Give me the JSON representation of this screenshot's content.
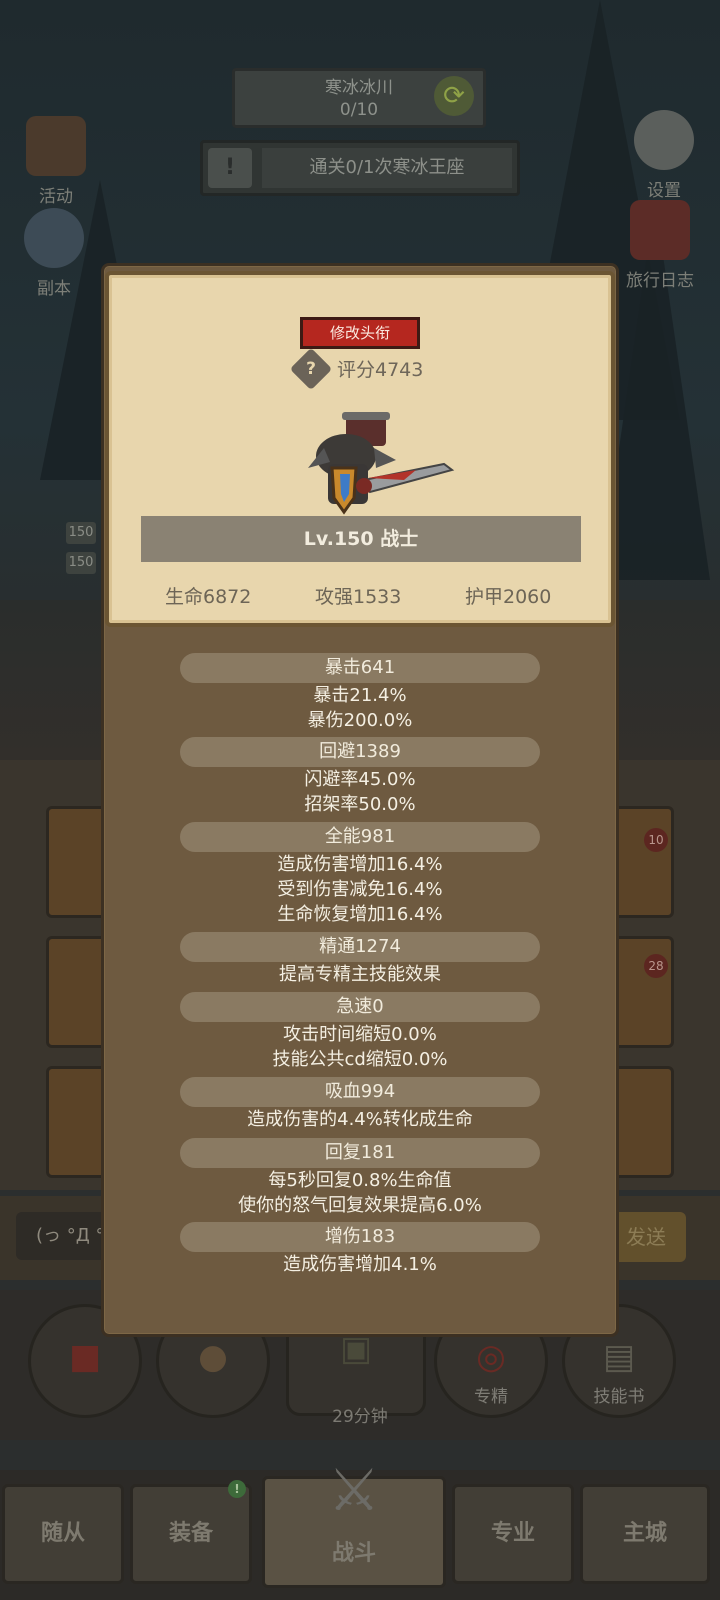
{
  "top": {
    "stage_name": "寒冰冰川",
    "stage_progress": "0/10",
    "quest_text": "通关0/1次寒冰王座",
    "left_menu": [
      "活动",
      "副本"
    ],
    "right_menu": [
      "设置",
      "旅行日志"
    ],
    "level_tags": [
      "150",
      "150"
    ]
  },
  "profile": {
    "edit_title_label": "修改头衔",
    "help_glyph": "?",
    "score": "评分4743",
    "level_class": "Lv.150 战士",
    "basic": [
      "生命6872",
      "攻强1533",
      "护甲2060"
    ]
  },
  "stats": {
    "crit_header": "暴击641",
    "crit_lines": [
      "暴击21.4%",
      "暴伤200.0%"
    ],
    "avoid_header": "回避1389",
    "avoid_lines": [
      "闪避率45.0%",
      "招架率50.0%"
    ],
    "versa_header": "全能981",
    "versa_lines": [
      "造成伤害增加16.4%",
      "受到伤害减免16.4%",
      "生命恢复增加16.4%"
    ],
    "mastery_header": "精通1274",
    "mastery_lines": [
      "提高专精主技能效果"
    ],
    "haste_header": "急速0",
    "haste_lines": [
      "攻击时间缩短0.0%",
      "技能公共cd缩短0.0%"
    ],
    "leech_header": "吸血994",
    "leech_lines": [
      "造成伤害的4.4%转化成生命"
    ],
    "regen_header": "回复181",
    "regen_lines": [
      "每5秒回复0.8%生命值",
      "使你的怒气回复效果提高6.0%"
    ],
    "dmg_header": "增伤183",
    "dmg_lines": [
      "造成伤害增加4.1%"
    ]
  },
  "lower": {
    "chat_placeholder": "(っ °Д °",
    "send_label": "发送",
    "badges": [
      "10",
      "28"
    ],
    "actions": [
      "专精",
      "技能书"
    ],
    "chest_timer": "29分钟",
    "tabs": [
      "随从",
      "装备",
      "战斗",
      "专业",
      "主城"
    ],
    "notif": "!"
  },
  "colors": {
    "title_button": "#b5271f",
    "card_bg": "#e8d6ad",
    "panel_bg": "#6e5a40",
    "stat_pill": "#8a7a62"
  }
}
